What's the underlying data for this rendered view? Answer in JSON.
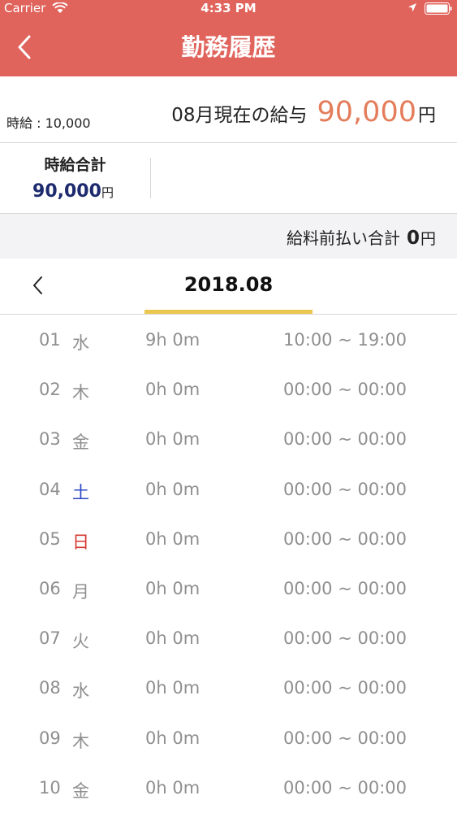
{
  "status_bar": {
    "carrier": "Carrier",
    "time": "4:33 PM"
  },
  "nav": {
    "title": "勤務履歴"
  },
  "wage": {
    "hourly_rate": "時給 : 10,000",
    "month_label": "08月現在の給与",
    "month_amount": "90,000",
    "month_unit": "円"
  },
  "summary": {
    "label": "時給合計",
    "amount": "90,000",
    "unit": "円"
  },
  "advance": {
    "label": "給料前払い合計",
    "amount": "0",
    "unit": "円"
  },
  "calendar": {
    "month": "2018.08"
  },
  "colors": {
    "header": "#e0635c",
    "accent_amount": "#e47d5b",
    "summary_amount": "#1d2a6e",
    "tab_underline": "#ecc74f",
    "saturday": "#2a47c2",
    "sunday": "#d6372f",
    "row_text": "#8f8f8f"
  },
  "days": [
    {
      "day": "01",
      "weekday": "水",
      "duration": "9h 0m",
      "time": "10:00 ~ 19:00"
    },
    {
      "day": "02",
      "weekday": "木",
      "duration": "0h 0m",
      "time": "00:00 ~ 00:00"
    },
    {
      "day": "03",
      "weekday": "金",
      "duration": "0h 0m",
      "time": "00:00 ~ 00:00"
    },
    {
      "day": "04",
      "weekday": "土",
      "duration": "0h 0m",
      "time": "00:00 ~ 00:00"
    },
    {
      "day": "05",
      "weekday": "日",
      "duration": "0h 0m",
      "time": "00:00 ~ 00:00"
    },
    {
      "day": "06",
      "weekday": "月",
      "duration": "0h 0m",
      "time": "00:00 ~ 00:00"
    },
    {
      "day": "07",
      "weekday": "火",
      "duration": "0h 0m",
      "time": "00:00 ~ 00:00"
    },
    {
      "day": "08",
      "weekday": "水",
      "duration": "0h 0m",
      "time": "00:00 ~ 00:00"
    },
    {
      "day": "09",
      "weekday": "木",
      "duration": "0h 0m",
      "time": "00:00 ~ 00:00"
    },
    {
      "day": "10",
      "weekday": "金",
      "duration": "0h 0m",
      "time": "00:00 ~ 00:00"
    }
  ]
}
